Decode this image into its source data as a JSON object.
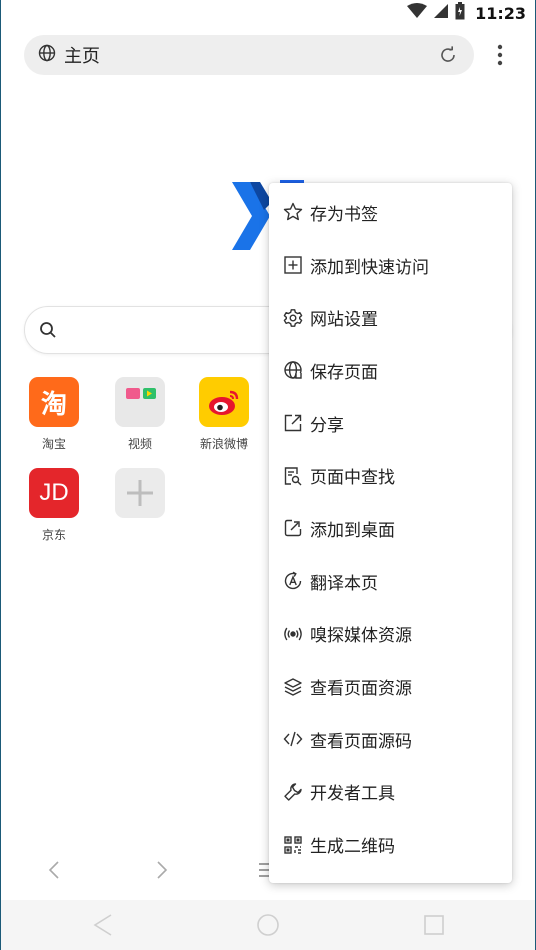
{
  "status_bar": {
    "time": "11:23"
  },
  "address_bar": {
    "title": "主页"
  },
  "shortcuts": [
    {
      "label": "淘宝",
      "glyph": "淘",
      "color": "#ff6a1a"
    },
    {
      "label": "视频"
    },
    {
      "label": "新浪微博"
    },
    {
      "label": "京东",
      "glyph": "JD",
      "color": "#e4262b"
    }
  ],
  "menu": {
    "items": [
      {
        "label": "存为书签",
        "icon": "star-icon"
      },
      {
        "label": "添加到快速访问",
        "icon": "plus-square-icon"
      },
      {
        "label": "网站设置",
        "icon": "gear-icon"
      },
      {
        "label": "保存页面",
        "icon": "globe-save-icon"
      },
      {
        "label": "分享",
        "icon": "share-icon"
      },
      {
        "label": "页面中查找",
        "icon": "find-in-page-icon"
      },
      {
        "label": "添加到桌面",
        "icon": "add-to-home-icon"
      },
      {
        "label": "翻译本页",
        "icon": "translate-icon"
      },
      {
        "label": "嗅探媒体资源",
        "icon": "sniff-media-icon"
      },
      {
        "label": "查看页面资源",
        "icon": "layers-icon"
      },
      {
        "label": "查看页面源码",
        "icon": "code-icon"
      },
      {
        "label": "开发者工具",
        "icon": "wrench-icon"
      },
      {
        "label": "生成二维码",
        "icon": "qr-code-icon"
      }
    ]
  }
}
